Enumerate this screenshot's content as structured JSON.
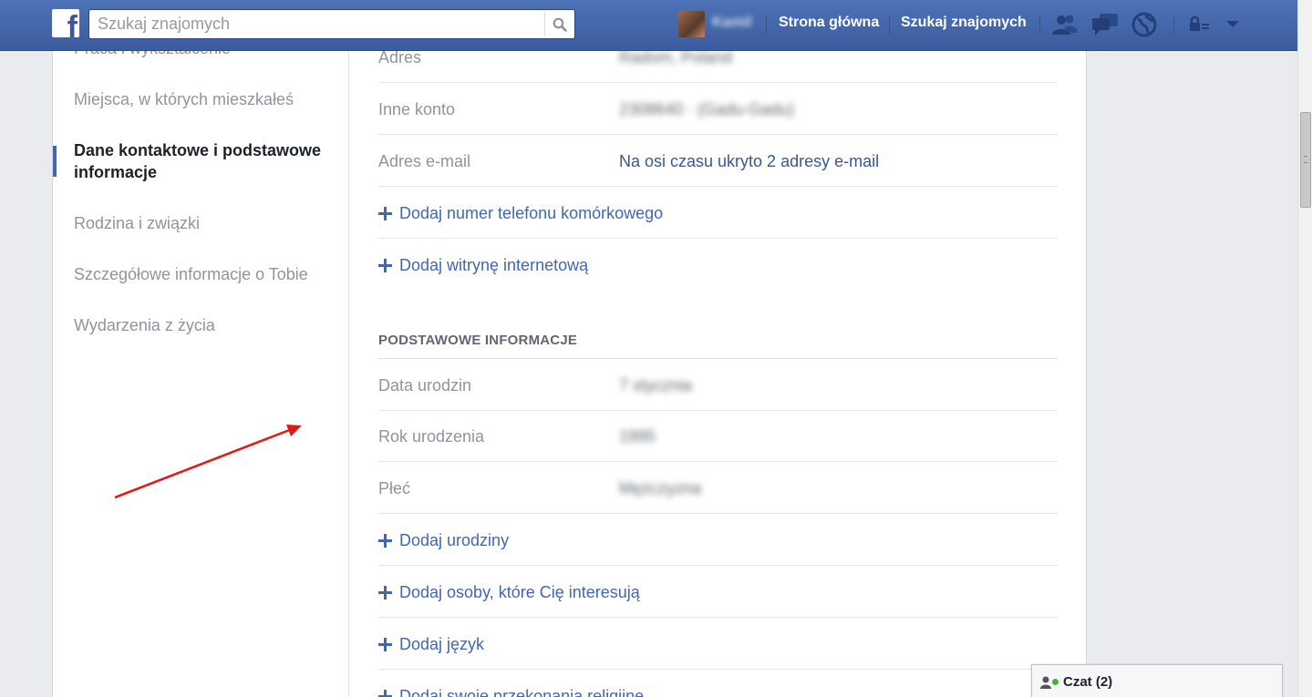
{
  "topbar": {
    "search_placeholder": "Szukaj znajomych",
    "user_name": "Kamil",
    "nav_home": "Strona główna",
    "nav_find_friends": "Szukaj znajomych",
    "brand_color": "#3b5998"
  },
  "sidebar": {
    "items": [
      {
        "label": "Praca i wykształcenie"
      },
      {
        "label": "Miejsca, w których mieszkałeś"
      },
      {
        "label": "Dane kontaktowe i podstawowe informacje"
      },
      {
        "label": "Rodzina i związki"
      },
      {
        "label": "Szczegółowe informacje o Tobie"
      },
      {
        "label": "Wydarzenia z życia"
      }
    ],
    "active_index": 2
  },
  "contact": {
    "address_label": "Adres",
    "address_value": "Radom, Poland",
    "other_account_label": "Inne konto",
    "other_account_value": "2308640 · (Gadu-Gadu)",
    "email_label": "Adres e-mail",
    "email_value": "Na osi czasu ukryto 2 adresy e-mail",
    "add_mobile": "Dodaj numer telefonu komórkowego",
    "add_website": "Dodaj witrynę internetową"
  },
  "basic": {
    "section_title": "PODSTAWOWE INFORMACJE",
    "birthday_label": "Data urodzin",
    "birthday_value": "7 stycznia",
    "birth_year_label": "Rok urodzenia",
    "birth_year_value": "1995",
    "gender_label": "Płeć",
    "gender_value": "Mężczyzna",
    "add_birthday": "Dodaj urodziny",
    "add_interested_in": "Dodaj osoby, które Cię interesują",
    "add_language": "Dodaj język",
    "add_religion": "Dodaj swoje przekonania religijne"
  },
  "chat": {
    "label": "Czat (2)"
  }
}
